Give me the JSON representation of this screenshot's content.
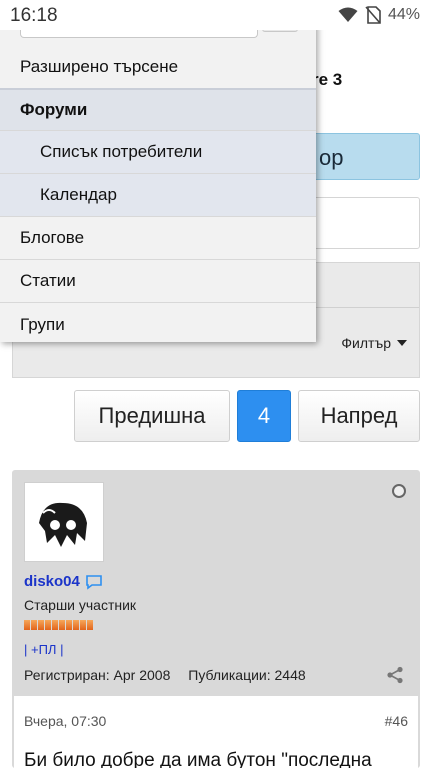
{
  "status_bar": {
    "time": "16:18",
    "battery": "44%"
  },
  "page": {
    "title_fragment": "re 3",
    "blue_button_fragment": "ор",
    "filter_label": "Филтър"
  },
  "pagination": {
    "prev": "Предишна",
    "current": "4",
    "next": "Напред"
  },
  "menu": {
    "advanced_search": "Разширено търсене",
    "forums": "Форуми",
    "members_list": "Списък потребители",
    "calendar": "Календар",
    "blogs": "Блогове",
    "articles": "Статии",
    "groups": "Групи"
  },
  "post": {
    "username": "disko04",
    "user_title": "Старши участник",
    "links": "| +ПЛ |",
    "registered": "Регистриран: Apr 2008",
    "posts": "Публикации: 2448",
    "date": "Вчера, 07:30",
    "number": "#46",
    "text": "Би било добре да има бутон \"последна"
  },
  "icons": [
    "wifi-icon",
    "no-sim-icon",
    "caret-down-icon",
    "chat-bubble-icon",
    "share-icon",
    "online-status-icon"
  ],
  "colors": {
    "accent_blue": "#2d8ff0",
    "username_blue": "#1b34c9",
    "post_bg": "#d9d9d9"
  }
}
